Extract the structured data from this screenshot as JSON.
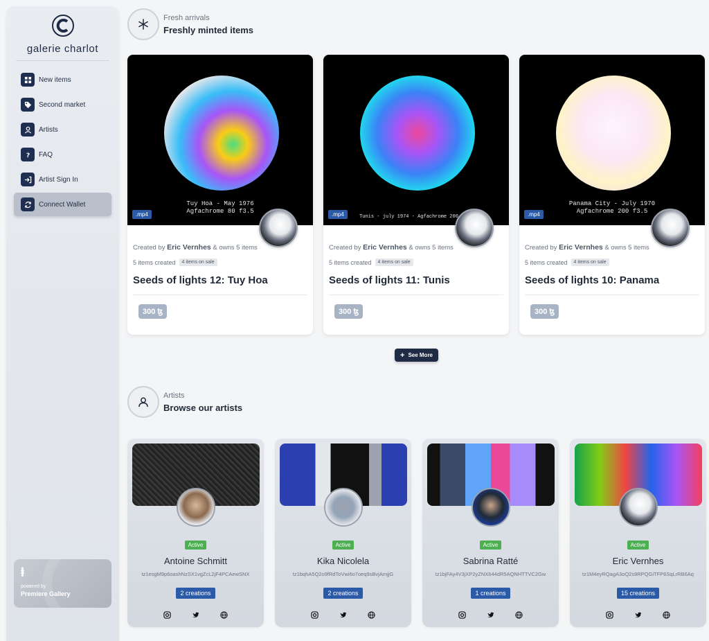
{
  "brand": {
    "name": "galerie charlot"
  },
  "nav": [
    {
      "label": "New items",
      "icon": "grid-icon"
    },
    {
      "label": "Second market",
      "icon": "tag-icon"
    },
    {
      "label": "Artists",
      "icon": "user-icon"
    },
    {
      "label": "FAQ",
      "icon": "question-icon"
    },
    {
      "label": "Artist Sign In",
      "icon": "sign-in-icon"
    },
    {
      "label": "Connect Wallet",
      "icon": "refresh-icon",
      "active": true
    }
  ],
  "powered": {
    "small": "powered by",
    "name": "Premiere Gallery"
  },
  "fresh": {
    "kicker": "Fresh arrivals",
    "title": "Freshly minted items"
  },
  "items": [
    {
      "caption_line1": "Tuy Hoa - May 1976",
      "caption_line2": "Agfachrome 80 f3.5",
      "format": ".mp4",
      "created_prefix": "Created by",
      "artist": "Eric Vernhes",
      "owns": "& owns 5 items",
      "items_created": "5 items created",
      "on_sale": "4 items on sale",
      "title": "Seeds of lights 12: Tuy Hoa",
      "price": "300 ꜩ"
    },
    {
      "caption_line1": "Tunis - july 1974 - Agfachrome 200 f3.5",
      "caption_line2": "",
      "format": ".mp4",
      "created_prefix": "Created by",
      "artist": "Eric Vernhes",
      "owns": "& owns 5 items",
      "items_created": "5 items created",
      "on_sale": "4 items on sale",
      "title": "Seeds of lights 11: Tunis",
      "price": "300 ꜩ"
    },
    {
      "caption_line1": "Panama City - July 1970",
      "caption_line2": "Agfachrome 200 f3.5",
      "format": ".mp4",
      "created_prefix": "Created by",
      "artist": "Eric Vernhes",
      "owns": "& owns 5 items",
      "items_created": "5 items created",
      "on_sale": "4 items on sale",
      "title": "Seeds of lights 10: Panama",
      "price": "300 ꜩ"
    }
  ],
  "see_more": {
    "label": "See More"
  },
  "artists_section": {
    "kicker": "Artists",
    "title": "Browse our artists"
  },
  "artists": [
    {
      "status": "Active",
      "name": "Antoine Schmitt",
      "address": "tz1esgM9p6oashNzSX1vgZcL2jF4PCAewSNX",
      "creations": "2 creations"
    },
    {
      "status": "Active",
      "name": "Kika Nicolela",
      "address": "tz1bqhA5Q2o9fRdToVwi6o7oeq9sBvjAmjjG",
      "creations": "2 creations"
    },
    {
      "status": "Active",
      "name": "Sabrina Ratté",
      "address": "tz1bjFAy4V3jXP2yZNX644dR5AQNHTTVC2Gw",
      "creations": "1 creations"
    },
    {
      "status": "Active",
      "name": "Eric Vernhes",
      "address": "tz1M4eyRQagA3oQ2s9RPQGiTFP6SqLrRB6Aq",
      "creations": "15 creations"
    }
  ],
  "colors": {
    "navy": "#1f2a44",
    "accent_blue": "#2b5aa8",
    "active_green": "#4caf50"
  }
}
